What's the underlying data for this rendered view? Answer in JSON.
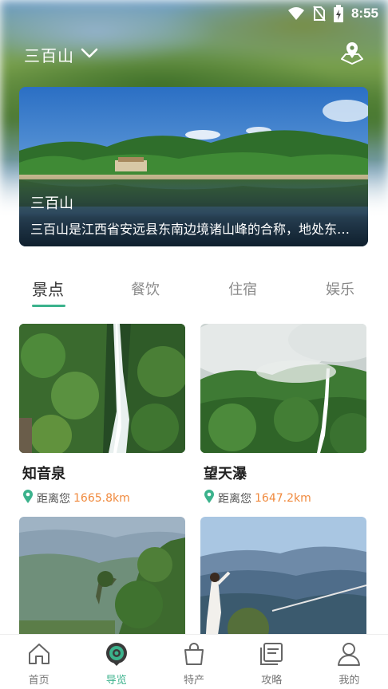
{
  "status_bar": {
    "time": "8:55"
  },
  "header": {
    "location": "三百山"
  },
  "banner": {
    "title": "三百山",
    "description": "三百山是江西省安远县东南边境诸山峰的合称，地处东江源头，风景秀丽"
  },
  "tabs": [
    {
      "label": "景点",
      "active": true
    },
    {
      "label": "餐饮",
      "active": false
    },
    {
      "label": "住宿",
      "active": false
    },
    {
      "label": "娱乐",
      "active": false
    }
  ],
  "cards": [
    {
      "title": "知音泉",
      "distance_prefix": "距离您",
      "distance": "1665.8km"
    },
    {
      "title": "望天瀑",
      "distance_prefix": "距离您",
      "distance": "1647.2km"
    },
    {
      "title": "",
      "distance_prefix": "",
      "distance": ""
    },
    {
      "title": "",
      "distance_prefix": "",
      "distance": ""
    }
  ],
  "bottom_nav": [
    {
      "label": "首页",
      "icon": "home-icon",
      "active": false
    },
    {
      "label": "导览",
      "icon": "guide-icon",
      "active": true
    },
    {
      "label": "特产",
      "icon": "shopping-bag-icon",
      "active": false
    },
    {
      "label": "攻略",
      "icon": "notes-icon",
      "active": false
    },
    {
      "label": "我的",
      "icon": "user-icon",
      "active": false
    }
  ],
  "colors": {
    "accent": "#3bb28c",
    "distance": "#f08a3e"
  }
}
